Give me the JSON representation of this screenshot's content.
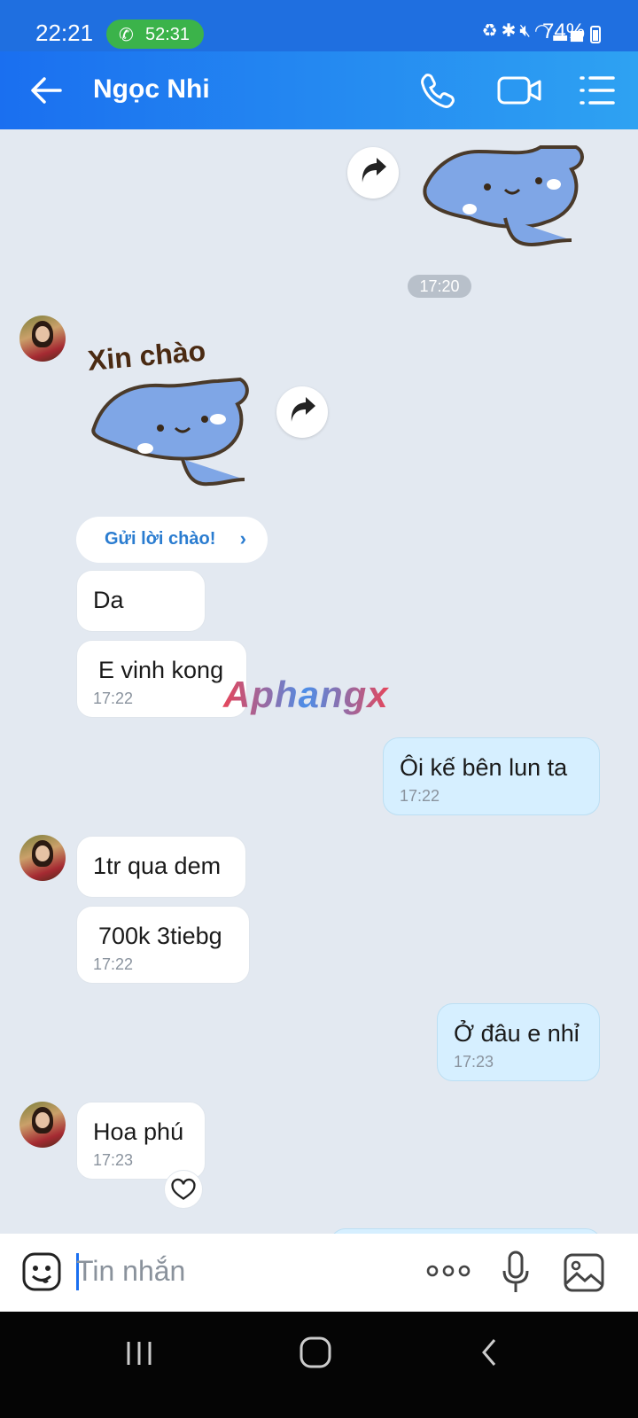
{
  "status_bar": {
    "time": "22:21",
    "call_duration": "52:31",
    "battery": "74%",
    "battery_level": 0.74,
    "icons": [
      "recycle-icon",
      "bluetooth-icon",
      "mute-icon",
      "wifi-icon",
      "signal-icon",
      "signal-icon-2"
    ]
  },
  "header": {
    "title": "Ngọc Nhi",
    "icons": [
      "back-arrow-icon",
      "phone-icon",
      "video-camera-icon",
      "menu-list-icon"
    ]
  },
  "chat": {
    "time_separator": "17:20",
    "sticker_text": "Xin chào",
    "greeting_button": {
      "label": "Gửi lời chào!"
    },
    "messages": [
      {
        "sender": "them",
        "text": "Da",
        "time": ""
      },
      {
        "sender": "them",
        "text": "E vinh kong",
        "time": "17:22"
      },
      {
        "sender": "me",
        "text": "Ôi kế bên lun ta",
        "time": "17:22"
      },
      {
        "sender": "them",
        "text": "1tr qua dem",
        "time": ""
      },
      {
        "sender": "them",
        "text": "700k 3tiebg",
        "time": "17:22"
      },
      {
        "sender": "me",
        "text": "Ở đâu e nhỉ",
        "time": "17:23"
      },
      {
        "sender": "them",
        "text": "Hoa phú",
        "time": "17:23"
      }
    ]
  },
  "watermark": "Aphangx",
  "input": {
    "placeholder": "Tin nhắn"
  },
  "colors": {
    "header": "#1a6ff0",
    "my_bubble": "#d6efff",
    "background": "#e3e9f1",
    "accent": "#2a7cd0"
  }
}
